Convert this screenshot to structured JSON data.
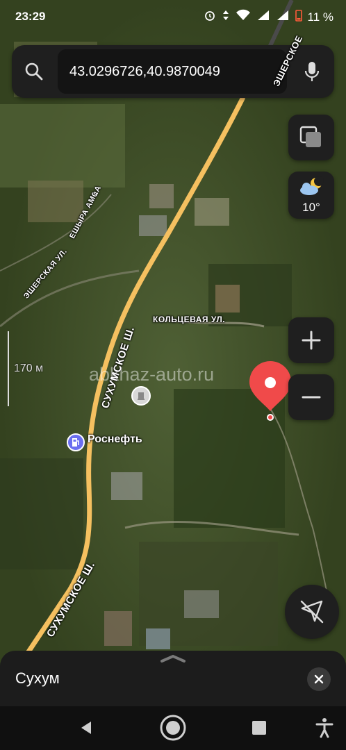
{
  "status_bar": {
    "time": "23:29",
    "battery": "11 %"
  },
  "search": {
    "value": "43.0296726,40.9870049"
  },
  "weather": {
    "temperature": "10°"
  },
  "map": {
    "scale": "170 м",
    "watermark": "abkhaz-auto.ru",
    "labels": {
      "road_top": "ЭШЕРСКОЕ",
      "street_esherskaya": "ЭШЕРСКАЯ УЛ.",
      "street_eshyra": "ЕШЫРА АМҨА",
      "street_koltsevaya": "КОЛЬЦЕВАЯ УЛ.",
      "road_sukhumskoe_1": "СУХУМСКОЕ Ш.",
      "road_sukhumskoe_2": "СУХУМСКОЕ Ш."
    },
    "poi": {
      "name": "Роснефть"
    }
  },
  "bottom_sheet": {
    "title": "Сухум"
  },
  "colors": {
    "accent_pin": "#f04a4a",
    "road": "#f5c060",
    "panel": "#1f1f1f"
  }
}
